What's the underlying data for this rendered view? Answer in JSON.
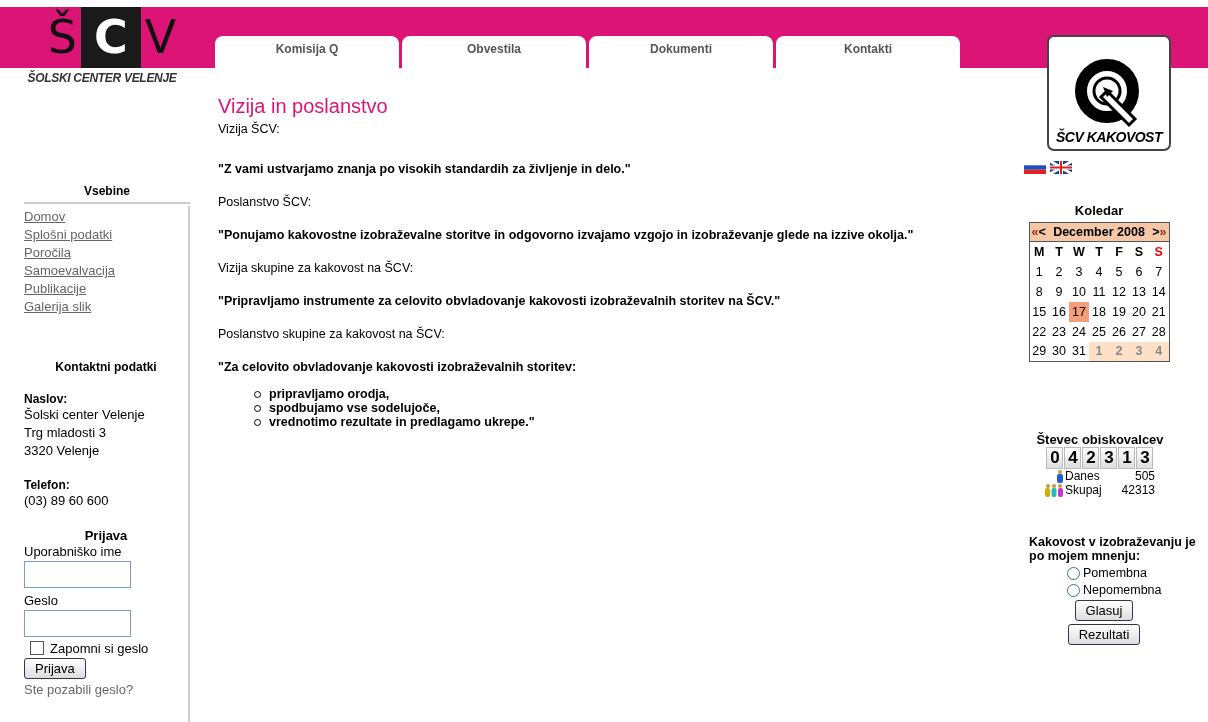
{
  "logo": {
    "letters": [
      "Š",
      "C",
      "V"
    ],
    "caption": "ŠOLSKI CENTER VELENJE"
  },
  "tabs": [
    {
      "label": "Komisija Q",
      "selected": false
    },
    {
      "label": "Obvestila",
      "selected": false
    },
    {
      "label": "Dokumenti",
      "selected": false
    },
    {
      "label": "Kontakti",
      "selected": false
    }
  ],
  "sidebar": {
    "menu_title": "Vsebine",
    "links": [
      "Domov",
      "Splošni podatki",
      "Poročila",
      "Samoevalvacija",
      "Publikacije",
      "Galerija slik"
    ],
    "contact_title": "Kontaktni podatki",
    "contact": [
      {
        "label": "Naslov:",
        "lines": [
          "Šolski center Velenje",
          "Trg mladosti 3",
          "3320 Velenje"
        ]
      },
      {
        "label": "Telefon:",
        "lines": [
          "(03) 89 60 600"
        ]
      }
    ],
    "login": {
      "title": "Prijava",
      "username_label": "Uporabniško ime",
      "password_label": "Geslo",
      "remember": {
        "label": "Zapomni si geslo",
        "checked": false
      },
      "button": "Prijava",
      "forgot": "Ste pozabili geslo?"
    }
  },
  "content": {
    "title": "Vizija in poslanstvo",
    "blocks": [
      {
        "kind": "text",
        "text": "Vizija ŠCV:"
      },
      {
        "kind": "bold",
        "text": "\"Z vami ustvarjamo znanja po visokih standardih za življenje in delo.\""
      },
      {
        "kind": "plain",
        "text": "Poslanstvo ŠCV:"
      },
      {
        "kind": "bold",
        "text": "\"Ponujamo kakovostne izobraževalne storitve in odgovorno izvajamo vzgojo in izobraževanje glede na izzive okolja.\""
      },
      {
        "kind": "plain",
        "text": "Vizija skupine za kakovost na ŠCV:"
      },
      {
        "kind": "bold",
        "text": "\"Pripravljamo instrumente za celovito obvladovanje kakovosti izobraževalnih storitev na ŠCV.\""
      },
      {
        "kind": "plain",
        "text": "Poslanstvo skupine za kakovost na ŠCV:"
      },
      {
        "kind": "bold",
        "text": "\"Za celovito obvladovanje kakovosti izobraževalnih storitev:"
      },
      {
        "kind": "list",
        "items": [
          "pripravljamo orodja,",
          "spodbujamo vse sodelujoče,",
          "vrednotimo rezultate in predlagamo ukrepe.\""
        ]
      }
    ]
  },
  "right": {
    "logo_caption": "ŠCV KAKOVOST",
    "calendar": {
      "title": "Koledar",
      "prev": [
        "«",
        "<"
      ],
      "month": "December 2008",
      "next": [
        ">",
        "»"
      ],
      "weekdays": [
        {
          "label": "M",
          "sunday": false
        },
        {
          "label": "T",
          "sunday": false
        },
        {
          "label": "W",
          "sunday": false
        },
        {
          "label": "T",
          "sunday": false
        },
        {
          "label": "F",
          "sunday": false
        },
        {
          "label": "S",
          "sunday": false
        },
        {
          "label": "S",
          "sunday": true
        }
      ],
      "weeks": [
        [
          {
            "day": "1",
            "kind": "day"
          },
          {
            "day": "2",
            "kind": "day"
          },
          {
            "day": "3",
            "kind": "day"
          },
          {
            "day": "4",
            "kind": "day"
          },
          {
            "day": "5",
            "kind": "day"
          },
          {
            "day": "6",
            "kind": "day"
          },
          {
            "day": "7",
            "kind": "day"
          }
        ],
        [
          {
            "day": "8",
            "kind": "day"
          },
          {
            "day": "9",
            "kind": "day"
          },
          {
            "day": "10",
            "kind": "day"
          },
          {
            "day": "11",
            "kind": "day"
          },
          {
            "day": "12",
            "kind": "day"
          },
          {
            "day": "13",
            "kind": "day"
          },
          {
            "day": "14",
            "kind": "day"
          }
        ],
        [
          {
            "day": "15",
            "kind": "day"
          },
          {
            "day": "16",
            "kind": "day"
          },
          {
            "day": "17",
            "kind": "today"
          },
          {
            "day": "18",
            "kind": "day"
          },
          {
            "day": "19",
            "kind": "day"
          },
          {
            "day": "20",
            "kind": "day"
          },
          {
            "day": "21",
            "kind": "day"
          }
        ],
        [
          {
            "day": "22",
            "kind": "day"
          },
          {
            "day": "23",
            "kind": "day"
          },
          {
            "day": "24",
            "kind": "day"
          },
          {
            "day": "25",
            "kind": "day"
          },
          {
            "day": "26",
            "kind": "day"
          },
          {
            "day": "27",
            "kind": "day"
          },
          {
            "day": "28",
            "kind": "day"
          }
        ],
        [
          {
            "day": "29",
            "kind": "day"
          },
          {
            "day": "30",
            "kind": "day"
          },
          {
            "day": "31",
            "kind": "day"
          },
          {
            "day": "1",
            "kind": "other"
          },
          {
            "day": "2",
            "kind": "other"
          },
          {
            "day": "3",
            "kind": "other"
          },
          {
            "day": "4",
            "kind": "other"
          }
        ]
      ]
    },
    "counter": {
      "title": "Števec obiskovalcev",
      "digits": [
        "0",
        "4",
        "2",
        "3",
        "1",
        "3"
      ],
      "rows": [
        {
          "kind": "single",
          "label": "Danes",
          "value": "505"
        },
        {
          "kind": "group",
          "label": "Skupaj",
          "value": "42313"
        }
      ]
    },
    "poll": {
      "question": "Kakovost v izobraževanju je po mojem mnenju:",
      "options": [
        {
          "label": "Pomembna",
          "selected": false
        },
        {
          "label": "Nepomembna",
          "selected": false
        }
      ],
      "buttons": [
        "Glasuj",
        "Rezultati"
      ]
    }
  }
}
